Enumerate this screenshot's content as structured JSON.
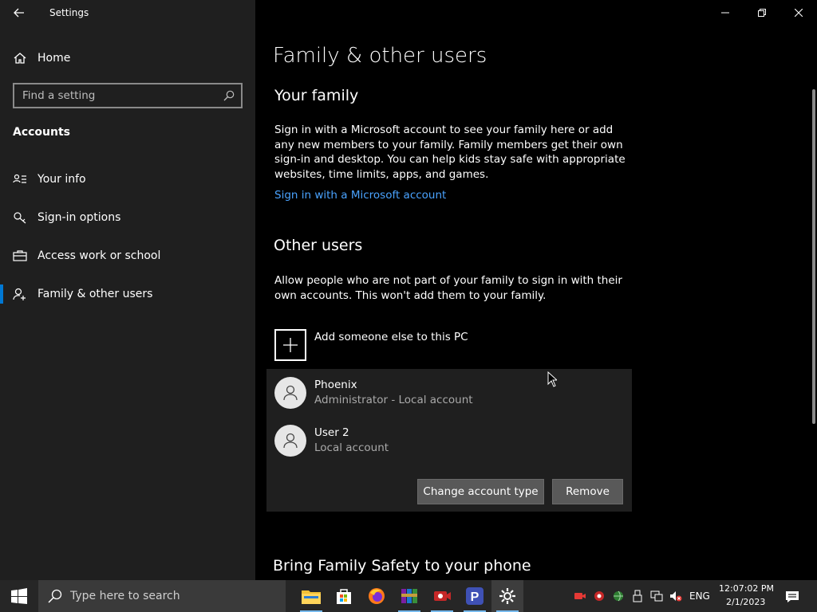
{
  "window": {
    "title": "Settings"
  },
  "sidebar": {
    "home": "Home",
    "search_placeholder": "Find a setting",
    "section": "Accounts",
    "items": [
      {
        "label": "Your info",
        "icon": "contact-card-icon"
      },
      {
        "label": "Sign-in options",
        "icon": "key-icon"
      },
      {
        "label": "Access work or school",
        "icon": "briefcase-icon"
      },
      {
        "label": "Family & other users",
        "icon": "person-add-icon",
        "selected": true
      }
    ]
  },
  "main": {
    "title": "Family & other users",
    "family": {
      "heading": "Your family",
      "text": "Sign in with a Microsoft account to see your family here or add any new members to your family. Family members get their own sign-in and desktop. You can help kids stay safe with appropriate websites, time limits, apps, and games.",
      "link": "Sign in with a Microsoft account"
    },
    "other": {
      "heading": "Other users",
      "text": "Allow people who are not part of your family to sign in with their own accounts. This won't add them to your family.",
      "add_label": "Add someone else to this PC",
      "users": [
        {
          "name": "Phoenix",
          "sub": "Administrator - Local account"
        },
        {
          "name": "User 2",
          "sub": "Local account"
        }
      ],
      "btn_change": "Change account type",
      "btn_remove": "Remove"
    },
    "phone_heading": "Bring Family Safety to your phone"
  },
  "taskbar": {
    "search_placeholder": "Type here to search",
    "lang": "ENG",
    "time": "12:07:02 PM",
    "date": "2/1/2023",
    "accent": "#0078d4"
  }
}
